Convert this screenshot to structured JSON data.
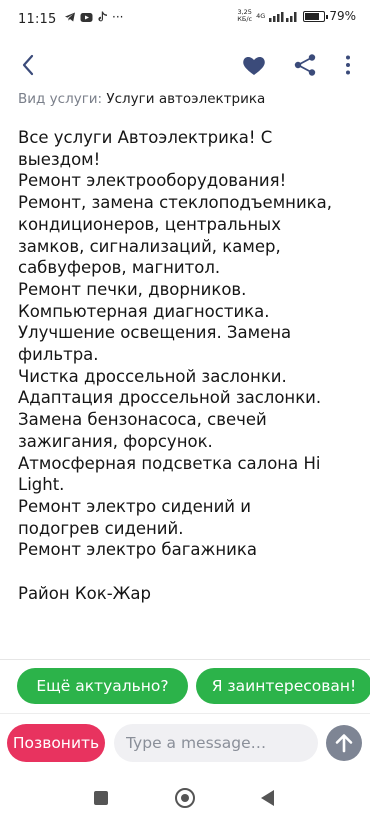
{
  "status_bar": {
    "time": "11:15",
    "net_speed_value": "3,25",
    "net_speed_unit": "КБ/с",
    "network": "4G",
    "battery_percent": "79%",
    "battery_level": 0.79
  },
  "toolbar": {
    "back_icon": "chevron-left-icon",
    "favorite_icon": "heart-icon",
    "share_icon": "share-icon",
    "more_icon": "more-vertical-icon"
  },
  "service": {
    "label": "Вид услуги:",
    "value": "Услуги автоэлектрика"
  },
  "description": {
    "lines": [
      "Все услуги Автоэлектрика! С",
      "выездом!",
      "Ремонт электрооборудования!",
      "Ремонт, замена стеклоподъемника,",
      "кондиционеров, центральных",
      "замков, сигнализаций, камер,",
      "сабвуферов, магнитол.",
      "Ремонт печки, дворников.",
      "Компьютерная диагностика.",
      "Улучшение освещения. Замена",
      "фильтра.",
      "Чистка дроссельной заслонки.",
      "Адаптация дроссельной заслонки.",
      "Замена бензонасоса, свечей",
      "зажигания, форсунок.",
      "Атмосферная подсветка салона Hi",
      "Light.",
      "Ремонт электро сидений и",
      "подогрев сидений.",
      "Ремонт электро багажника",
      "",
      "Район Кок-Жар"
    ]
  },
  "quick_replies": [
    "Ещё актуально?",
    "Я заинтересован!"
  ],
  "bottom": {
    "call_label": "Позвонить",
    "message_placeholder": "Type a message…",
    "send_icon": "arrow-up-icon"
  },
  "colors": {
    "quick_reply_green": "#2cb34a",
    "call_pink": "#e8335f",
    "send_gray": "#7e8594"
  }
}
